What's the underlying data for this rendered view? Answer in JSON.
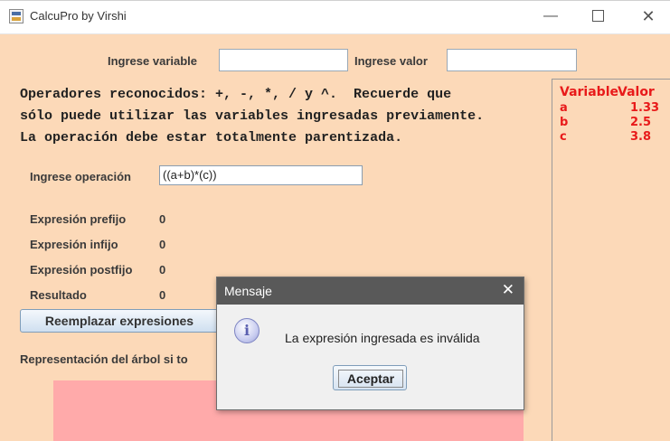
{
  "window": {
    "title": "CalcuPro by Virshi",
    "minimize": "—",
    "close": "✕"
  },
  "inputs": {
    "variable_label": "Ingrese variable",
    "variable_value": "",
    "value_label": "Ingrese valor",
    "value_value": "",
    "operation_label": "Ingrese operación",
    "operation_value": "((a+b)*(c))"
  },
  "instructions": [
    "Operadores reconocidos: +, -, *, / y ^.  Recuerde que",
    "sólo puede utilizar las variables ingresadas previamente.",
    "La operación debe estar totalmente parentizada."
  ],
  "results": {
    "prefix_label": "Expresión prefijo",
    "prefix_value": "0",
    "infix_label": "Expresión infijo",
    "infix_value": "0",
    "postfix_label": "Expresión postfijo",
    "postfix_value": "0",
    "result_label": "Resultado",
    "result_value": "0"
  },
  "replace_button": "Reemplazar expresiones",
  "tree_label": "Representación del árbol si to",
  "variables_panel": {
    "header_variable": "Variable",
    "header_valor": "Valor",
    "rows": [
      {
        "name": "a",
        "value": "1.33"
      },
      {
        "name": "b",
        "value": "2.5"
      },
      {
        "name": "c",
        "value": "3.8"
      }
    ],
    "color": "#e81a1a"
  },
  "dialog": {
    "title": "Mensaje",
    "close": "✕",
    "icon": "info-icon",
    "icon_glyph": "i",
    "message": "La expresión ingresada es inválida",
    "ok_button": "Aceptar"
  },
  "colors": {
    "background": "#fcd9b8",
    "tree_area": "#ffaaaa",
    "dialog_titlebar": "#595959"
  }
}
